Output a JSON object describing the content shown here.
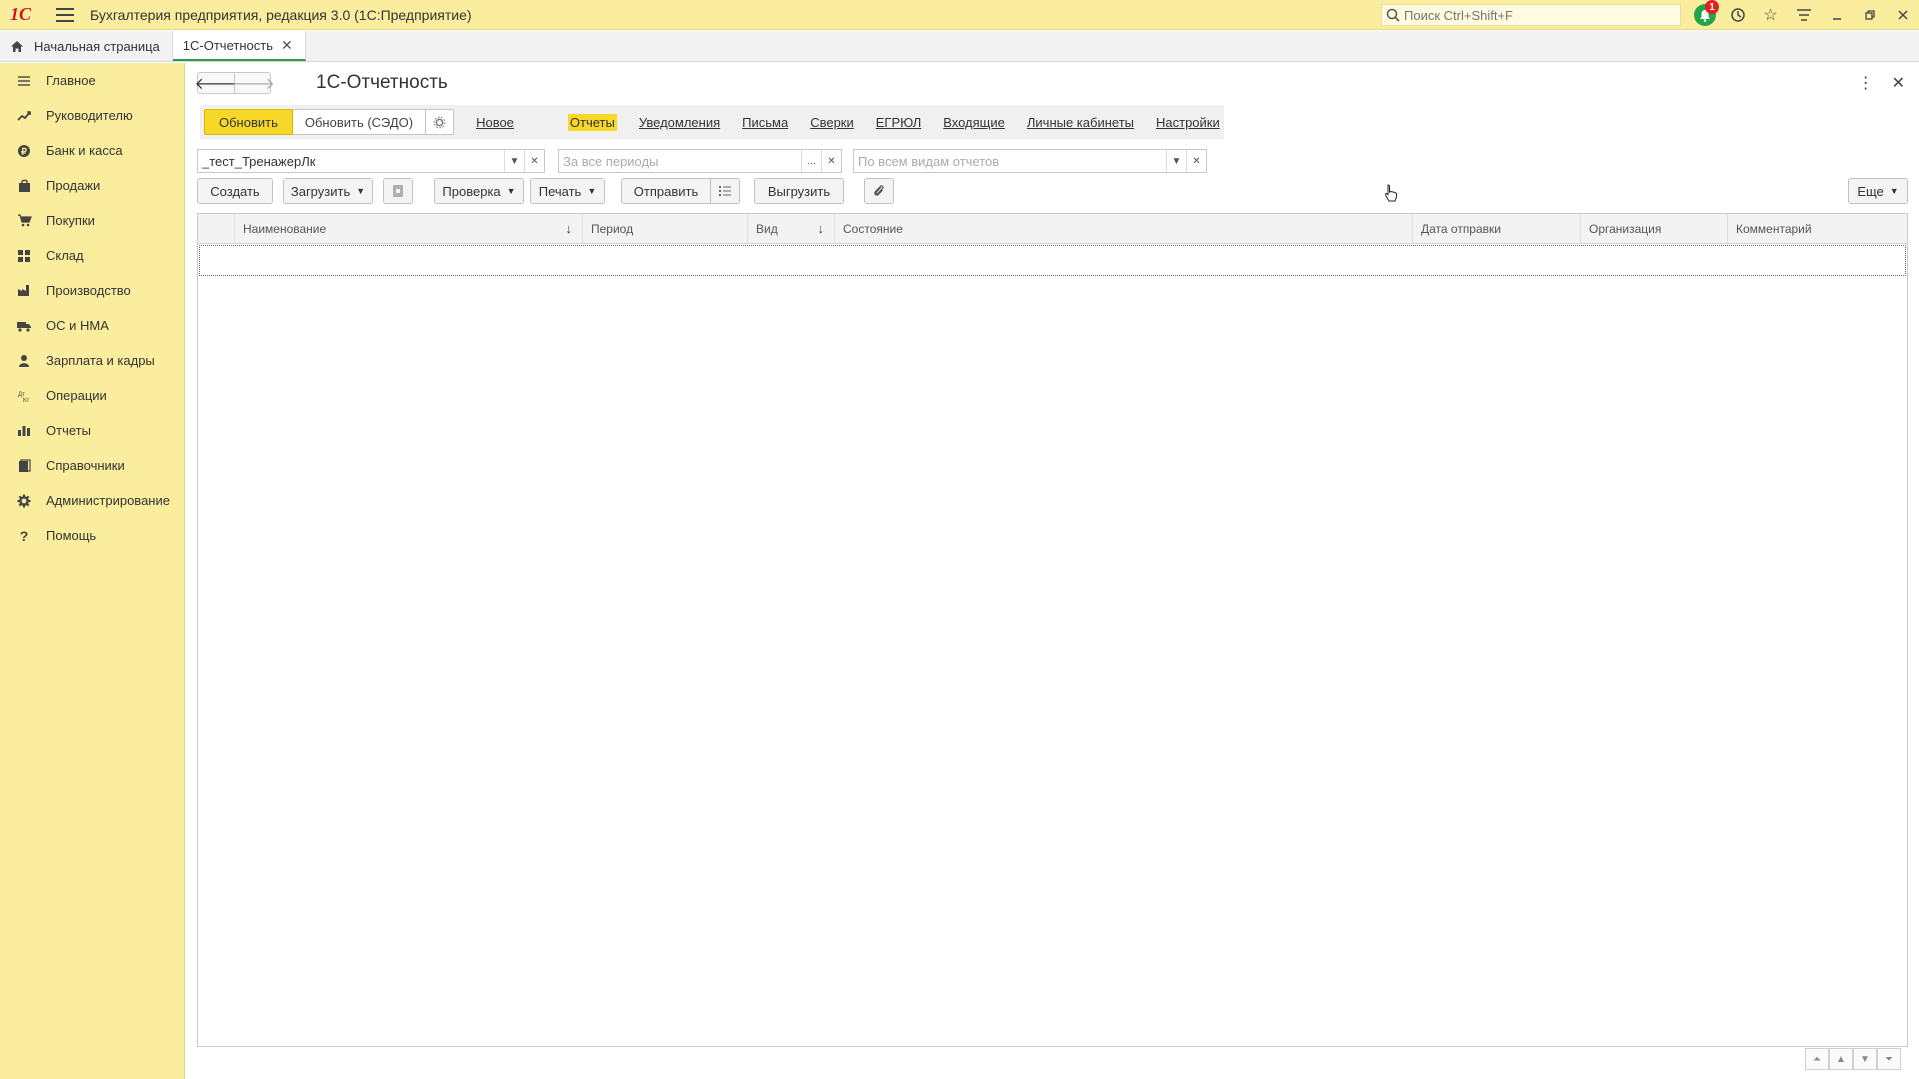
{
  "titlebar": {
    "logo": "1С",
    "title": "Бухгалтерия предприятия, редакция 3.0  (1С:Предприятие)",
    "search_placeholder": "Поиск Ctrl+Shift+F",
    "notifications_count": "1"
  },
  "tabs": [
    {
      "label": "Начальная страница"
    },
    {
      "label": "1С-Отчетность"
    }
  ],
  "sidebar": {
    "items": [
      {
        "label": "Главное",
        "icon": "menu-icon"
      },
      {
        "label": "Руководителю",
        "icon": "trend-icon"
      },
      {
        "label": "Банк и касса",
        "icon": "coin-icon"
      },
      {
        "label": "Продажи",
        "icon": "bag-icon"
      },
      {
        "label": "Покупки",
        "icon": "cart-icon"
      },
      {
        "label": "Склад",
        "icon": "grid-icon"
      },
      {
        "label": "Производство",
        "icon": "factory-icon"
      },
      {
        "label": "ОС и НМА",
        "icon": "truck-icon"
      },
      {
        "label": "Зарплата и кадры",
        "icon": "person-icon"
      },
      {
        "label": "Операции",
        "icon": "dt-kt-icon"
      },
      {
        "label": "Отчеты",
        "icon": "bar-chart-icon"
      },
      {
        "label": "Справочники",
        "icon": "book-icon"
      },
      {
        "label": "Администрирование",
        "icon": "gear-icon"
      },
      {
        "label": "Помощь",
        "icon": "question-icon"
      }
    ]
  },
  "form": {
    "title": "1С-Отчетность",
    "update_button": "Обновить",
    "update_sedo_button": "Обновить (СЭДО)",
    "links": {
      "new": "Новое",
      "reports": "Отчеты",
      "notifications": "Уведомления",
      "letters": "Письма",
      "reconciliations": "Сверки",
      "egrul": "ЕГРЮЛ",
      "incoming": "Входящие",
      "cabinets": "Личные кабинеты",
      "settings": "Настройки"
    },
    "filters": {
      "organization_value": "_тест_ТренажерЛк",
      "period_placeholder": "За все периоды",
      "report_types_placeholder": "По всем видам отчетов"
    },
    "toolbar": {
      "create": "Создать",
      "load": "Загрузить",
      "check": "Проверка",
      "print": "Печать",
      "send": "Отправить",
      "export": "Выгрузить",
      "more": "Еще"
    },
    "table": {
      "columns": [
        "Наименование",
        "Период",
        "Вид",
        "Состояние",
        "Дата отправки",
        "Организация",
        "Комментарий"
      ]
    }
  }
}
